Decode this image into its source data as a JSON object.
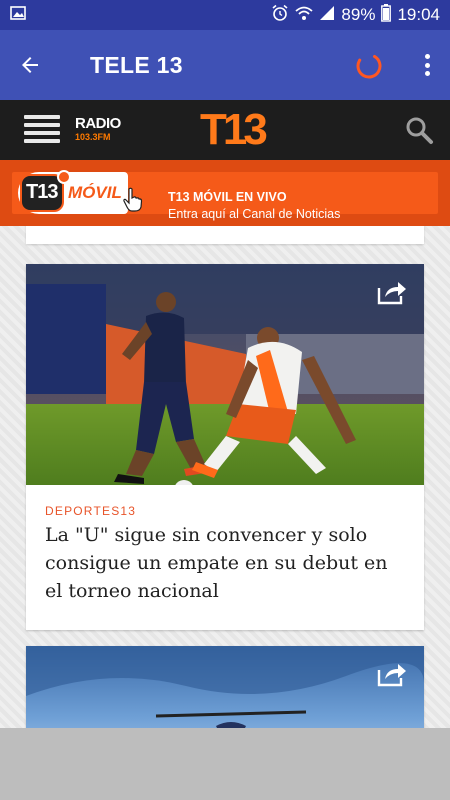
{
  "status_bar": {
    "battery": "89%",
    "time": "19:04",
    "icons": [
      "image-icon",
      "alarm-icon",
      "wifi-icon",
      "signal-icon",
      "battery-icon"
    ]
  },
  "app_bar": {
    "title": "TELE 13",
    "colors": {
      "background": "#3f51b5",
      "spinner": "#ff5722"
    }
  },
  "site_header": {
    "radio_label": "RADIO",
    "radio_freq": "103.3FM",
    "logo": "T13"
  },
  "banner": {
    "logo": "T13",
    "badge_word": "MÓVIL",
    "title": "T13 MÓVIL EN VIVO",
    "subtitle": "Entra aquí al Canal de Noticias"
  },
  "articles": [
    {
      "category": "DEPORTES13",
      "title": "La \"U\" sigue sin convencer y solo consigue un empate en su debut en el torneo nacional",
      "image": "soccer-match-photo"
    },
    {
      "category": "",
      "title": "",
      "image": "helicopter-sky-photo"
    }
  ]
}
